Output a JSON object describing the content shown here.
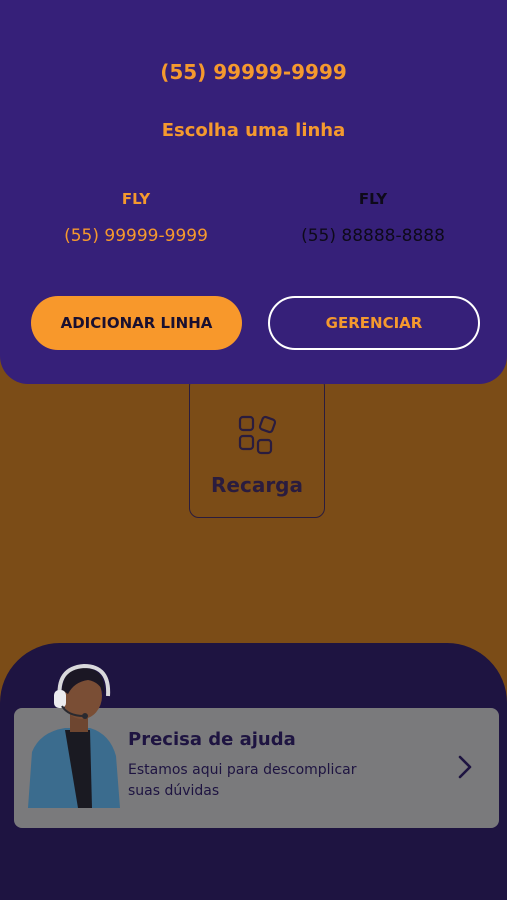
{
  "sheet": {
    "current_phone": "(55) 99999-9999",
    "choose_title": "Escolha uma linha",
    "lines": [
      {
        "name": "FLY",
        "number": "(55) 99999-9999"
      },
      {
        "name": "FLY",
        "number": "(55) 88888-8888"
      }
    ],
    "add_button": "ADICIONAR LINHA",
    "manage_button": "GERENCIAR"
  },
  "recarga": {
    "label": "Recarga",
    "icon": "apps-grid-icon"
  },
  "help": {
    "title": "Precisa de ajuda",
    "description": "Estamos aqui para descomplicar suas dúvidas",
    "icon": "chevron-right-icon",
    "avatar": "support-agent-avatar"
  },
  "colors": {
    "sheet_bg": "#362079",
    "accent_orange": "#f8982b",
    "page_bg_dimmed": "#7b4c17",
    "bottom_bg": "#1e1441"
  }
}
